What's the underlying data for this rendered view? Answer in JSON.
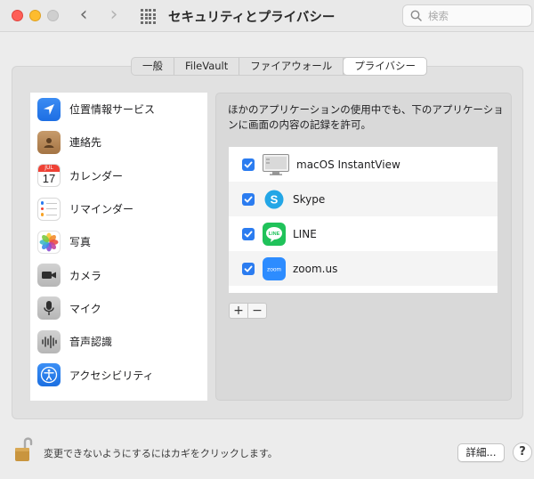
{
  "window": {
    "title": "セキュリティとプライバシー",
    "search_placeholder": "検索",
    "controls": {
      "close_color": "#fe5f57",
      "minimize_color": "#febc2e"
    }
  },
  "tabs": [
    {
      "label": "一般",
      "active": false
    },
    {
      "label": "FileVault",
      "active": false
    },
    {
      "label": "ファイアウォール",
      "active": false
    },
    {
      "label": "プライバシー",
      "active": true
    }
  ],
  "sidebar": {
    "items": [
      {
        "label": "位置情報サービス",
        "icon": "location-arrow-icon"
      },
      {
        "label": "連絡先",
        "icon": "contacts-icon"
      },
      {
        "label": "カレンダー",
        "icon": "calendar-icon",
        "icon_month": "JUL",
        "icon_day": "17"
      },
      {
        "label": "リマインダー",
        "icon": "reminders-icon"
      },
      {
        "label": "写真",
        "icon": "photos-icon"
      },
      {
        "label": "カメラ",
        "icon": "camera-icon"
      },
      {
        "label": "マイク",
        "icon": "microphone-icon"
      },
      {
        "label": "音声認識",
        "icon": "speech-recognition-icon"
      },
      {
        "label": "アクセシビリティ",
        "icon": "accessibility-icon"
      }
    ]
  },
  "main": {
    "description": "ほかのアプリケーションの使用中でも、下のアプリケーションに画面の内容の記録を許可。",
    "apps": [
      {
        "name": "macOS InstantView",
        "checked": true,
        "icon": "monitor-icon"
      },
      {
        "name": "Skype",
        "checked": true,
        "icon": "skype-icon"
      },
      {
        "name": "LINE",
        "checked": true,
        "icon": "line-icon",
        "icon_text": "LINE"
      },
      {
        "name": "zoom.us",
        "checked": true,
        "icon": "zoom-icon",
        "icon_text": "zoom"
      }
    ],
    "add_label": "+",
    "remove_label": "−"
  },
  "footer": {
    "lock_text": "変更できないようにするにはカギをクリックします。",
    "details_label": "詳細...",
    "help_label": "?"
  }
}
